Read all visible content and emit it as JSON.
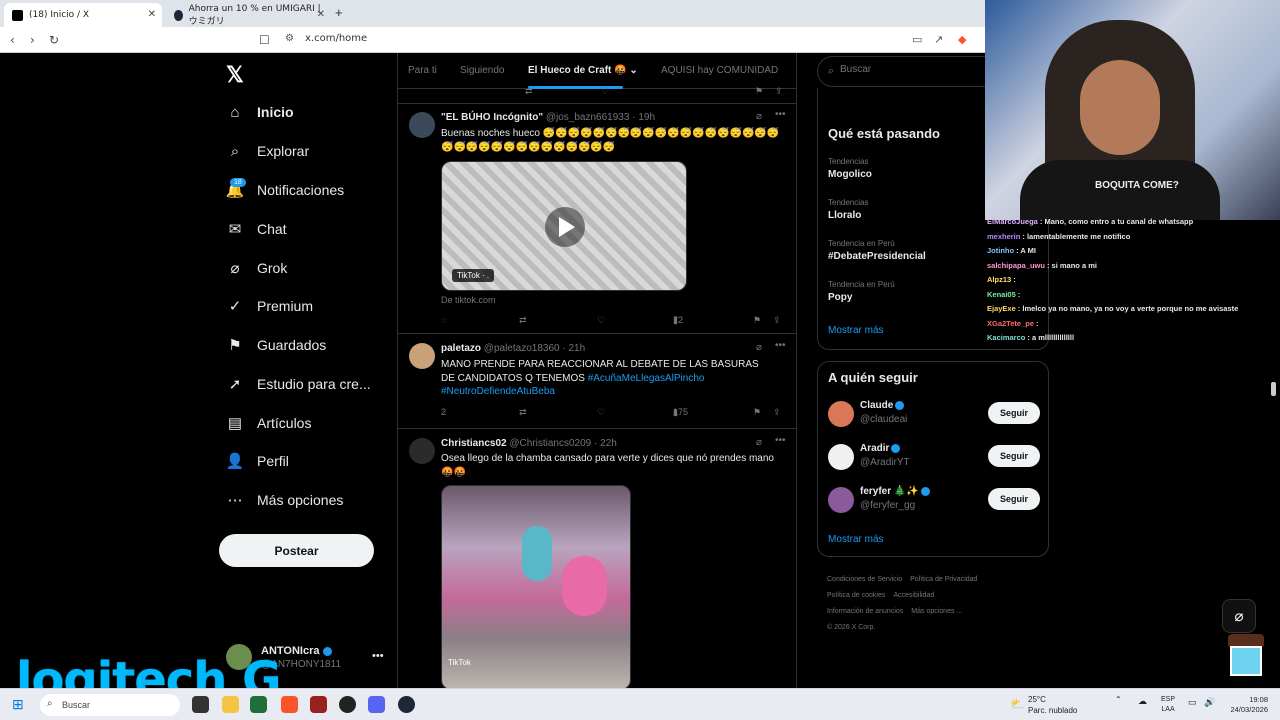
{
  "browser": {
    "tabs": [
      {
        "title": "(18) Inicio / X",
        "active": true
      },
      {
        "title": "Ahorra un 10 % en UMIGARI | ウミガリ",
        "active": false
      }
    ],
    "url": "x.com/home"
  },
  "nav": {
    "items": [
      {
        "label": "Inicio",
        "icon": "home-icon"
      },
      {
        "label": "Explorar",
        "icon": "search-icon"
      },
      {
        "label": "Notificaciones",
        "icon": "bell-icon"
      },
      {
        "label": "Chat",
        "icon": "mail-icon"
      },
      {
        "label": "Grok",
        "icon": "grok-icon"
      },
      {
        "label": "Premium",
        "icon": "premium-icon"
      },
      {
        "label": "Guardados",
        "icon": "bookmark-icon"
      },
      {
        "label": "Estudio para cre...",
        "icon": "rocket-icon"
      },
      {
        "label": "Artículos",
        "icon": "article-icon"
      },
      {
        "label": "Perfil",
        "icon": "person-icon"
      },
      {
        "label": "Más opciones",
        "icon": "more-icon"
      }
    ],
    "notif_count": "18",
    "post_label": "Postear",
    "account": {
      "name": "ANTONIcra",
      "handle": "@AN7HONY1811"
    }
  },
  "feed": {
    "tabs": [
      "Para ti",
      "Siguiendo",
      "El Hueco de Craft 🤬",
      "AQUISI hay COMUNIDAD"
    ],
    "posts": [
      {
        "author": "\"EL BÚHO Incógnito\"",
        "handle": "@jos_bazn661933",
        "time": "19h",
        "text": "Buenas noches hueco 😴😴😴😴😴😴😴😴😴😴😴😴😴😴😴😴😴😴😴😴😴😴😴😴😴😴😴😴😴😴😴😴😴",
        "media_label": "TikTok · .",
        "source": "De tiktok.com",
        "views": "72"
      },
      {
        "author": "paletazo",
        "handle": "@paletazo18360",
        "time": "21h",
        "text": "MANO PRENDE PARA REACCIONAR AL DEBATE DE LAS BASURAS DE CANDIDATOS Q TENEMOS",
        "hashtags": "#AcuñaMeLlegasAlPincho #NeutroDefiendeAtuBeba",
        "replies": "2",
        "views": "175"
      },
      {
        "author": "Christiancs02",
        "handle": "@Christiancs0209",
        "time": "22h",
        "text": "Osea llego de la chamba cansado para verte y dices que nó prendes mano 🤬🤬",
        "media_label": "TikTok"
      }
    ]
  },
  "sidebar": {
    "search_placeholder": "Buscar",
    "trends_title": "Qué está pasando",
    "trends": [
      {
        "cat": "Tendencias",
        "name": "Mogolico"
      },
      {
        "cat": "Tendencias",
        "name": "Lloralo"
      },
      {
        "cat": "Tendencia en Perú",
        "name": "#DebatePresidencial"
      },
      {
        "cat": "Tendencia en Perú",
        "name": "Popy"
      }
    ],
    "show_more": "Mostrar más",
    "follow_title": "A quién seguir",
    "follow": [
      {
        "name": "Claude",
        "handle": "@claudeai",
        "btn": "Seguir"
      },
      {
        "name": "Aradir",
        "handle": "@AradirYT",
        "btn": "Seguir"
      },
      {
        "name": "feryfer 🎄✨",
        "handle": "@feryfer_gg",
        "btn": "Seguir"
      }
    ],
    "footer": [
      "Condiciones de Servicio",
      "Política de Privacidad",
      "Política de cookies",
      "Accesibilidad",
      "Información de anuncios",
      "Más opciones ...",
      "© 2026 X Corp."
    ]
  },
  "stream": {
    "shirt_text": "BOQUITA COME?",
    "chat": [
      {
        "user": "ElMarcoJuega",
        "msg": ": Mano, como entro a tu canal de whatsapp",
        "color": "#e0b0ff"
      },
      {
        "user": "mexherin",
        "msg": ": lamentablemente me notifico",
        "color": "#b48cff"
      },
      {
        "user": "Jotinho",
        "msg": ": A MI",
        "color": "#7ec8ff"
      },
      {
        "user": "salchipapa_uwu",
        "msg": ": si mano a mi",
        "color": "#ff9ad5"
      },
      {
        "user": "Alpz13",
        "msg": ":",
        "color": "#ffe066"
      },
      {
        "user": "Kenai05",
        "msg": ":",
        "color": "#7cf0a0"
      },
      {
        "user": "EjayExe",
        "msg": ": lmelco ya no mano, ya no voy a verte porque no me avisaste",
        "color": "#ffd86b"
      },
      {
        "user": "XGa2Tete_pe",
        "msg": ":",
        "color": "#ff6b6b"
      },
      {
        "user": "Kacimarco",
        "msg": ": a mllllllllllllll",
        "color": "#7ee0d0"
      }
    ]
  },
  "overlay": {
    "brand": "logitech G"
  },
  "taskbar": {
    "search": "Buscar",
    "temp": "25°C",
    "weather": "Parc. nublado",
    "lang1": "ESP",
    "lang2": "LAA",
    "time": "19:08",
    "date": "24/03/2026"
  }
}
